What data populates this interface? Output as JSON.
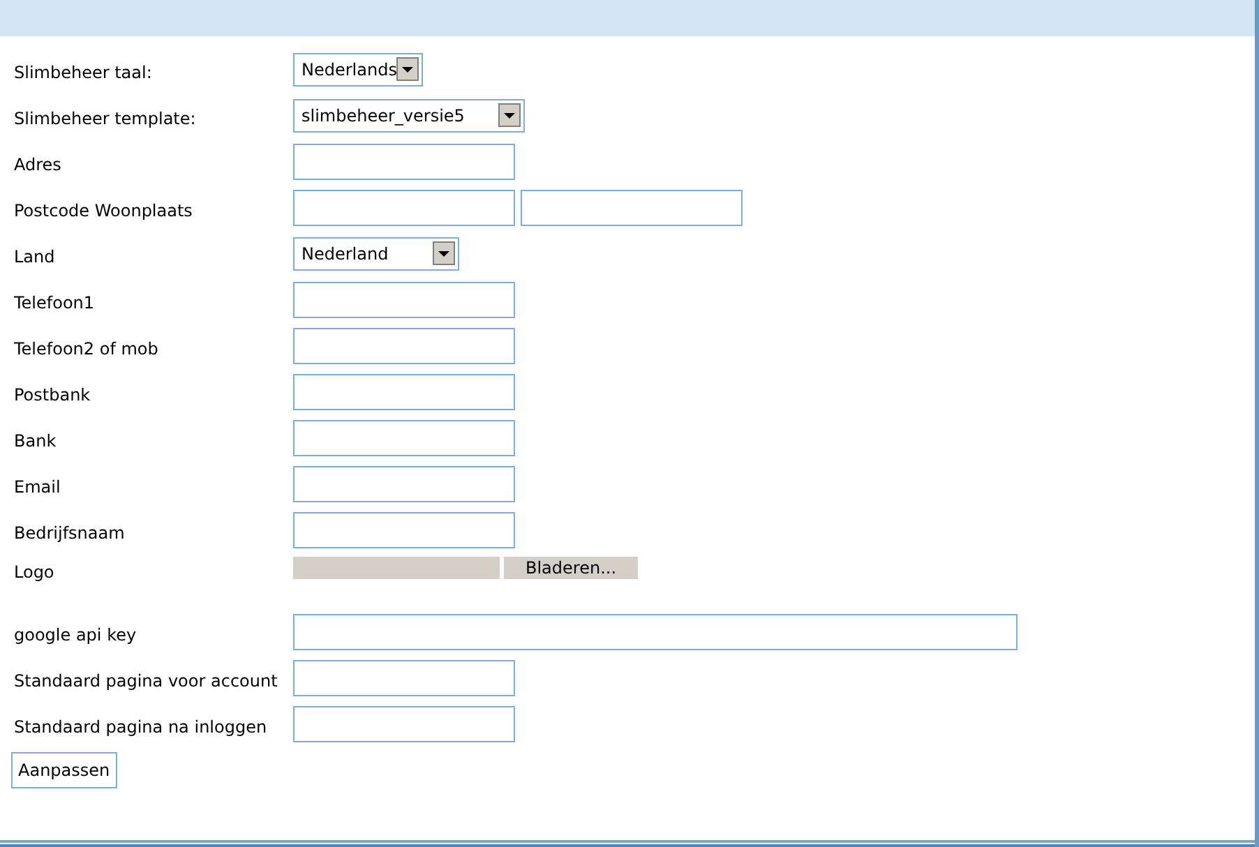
{
  "form": {
    "rows": [
      {
        "label": "Slimbeheer taal:",
        "kind": "select",
        "value": "Nederlands"
      },
      {
        "label": "Slimbeheer template:",
        "kind": "select",
        "value": "slimbeheer_versie5"
      },
      {
        "label": "Adres",
        "kind": "text"
      },
      {
        "label": "Postcode Woonplaats",
        "kind": "double"
      },
      {
        "label": "Land",
        "kind": "select",
        "value": "Nederland"
      },
      {
        "label": "Telefoon1",
        "kind": "text"
      },
      {
        "label": "Telefoon2 of mob",
        "kind": "text"
      },
      {
        "label": "Postbank",
        "kind": "text"
      },
      {
        "label": "Bank",
        "kind": "text"
      },
      {
        "label": "Email",
        "kind": "text"
      },
      {
        "label": "Bedrijfsnaam",
        "kind": "text"
      },
      {
        "label": "Logo",
        "kind": "file",
        "button": "Bladeren..."
      },
      {
        "label": "google api key",
        "kind": "wide"
      },
      {
        "label": "Standaard pagina voor account",
        "kind": "text"
      },
      {
        "label": "Standaard pagina na inloggen",
        "kind": "text"
      }
    ],
    "submit": "Aanpassen"
  }
}
